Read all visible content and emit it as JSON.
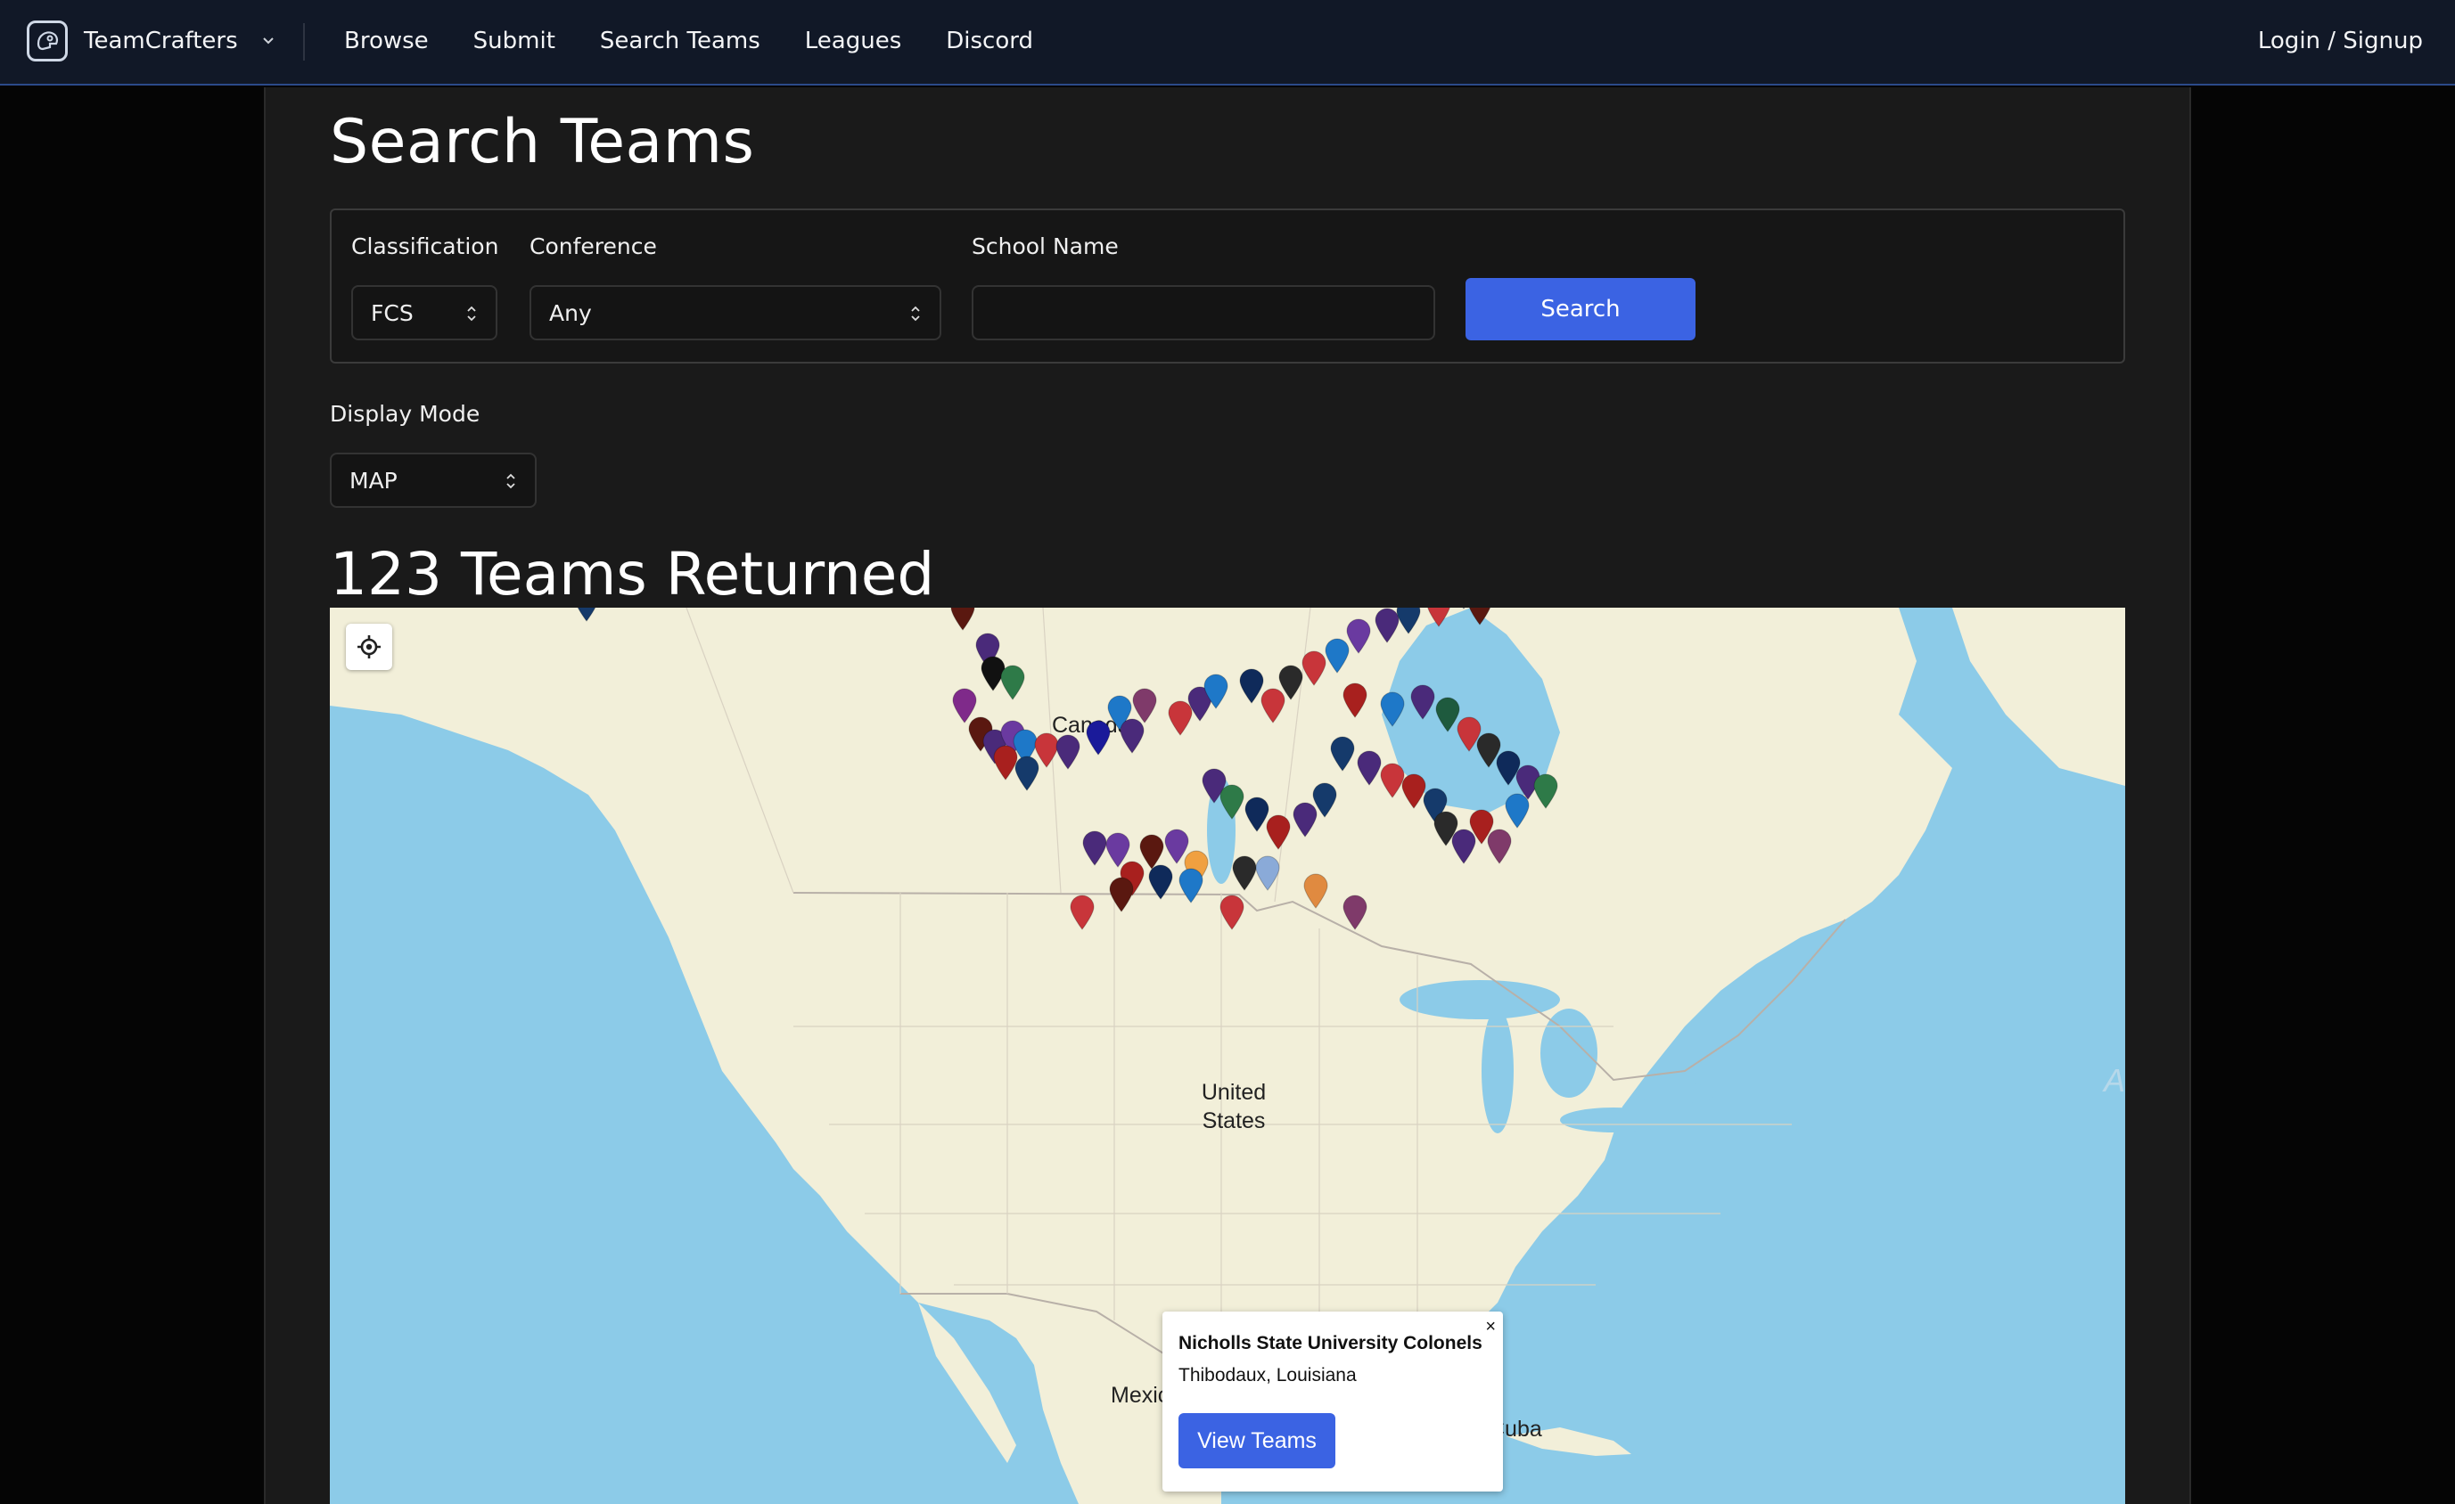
{
  "nav": {
    "brand": "TeamCrafters",
    "links": [
      "Browse",
      "Submit",
      "Search Teams",
      "Leagues",
      "Discord"
    ],
    "login": "Login / Signup"
  },
  "page": {
    "title": "Search Teams"
  },
  "filters": {
    "classification_label": "Classification",
    "classification_value": "FCS",
    "conference_label": "Conference",
    "conference_value": "Any",
    "school_label": "School Name",
    "school_value": "",
    "search_label": "Search"
  },
  "display": {
    "label": "Display Mode",
    "value": "MAP"
  },
  "results": {
    "title": "123 Teams Returned"
  },
  "map": {
    "labels": {
      "canada": "Canada",
      "us": "United\nStates",
      "mexico": "Mexico",
      "cuba": "Cuba",
      "atlantic": "A"
    },
    "popup": {
      "title": "Nicholls State University Colonels",
      "location": "Thibodaux, Louisiana",
      "close": "×",
      "button": "View Teams"
    }
  },
  "colors": {
    "accent": "#3b63e3",
    "navbar": "#111827",
    "ocean": "#8ccbe8",
    "land": "#f2efd9"
  },
  "icons": {
    "locate": "crosshair-icon",
    "brand": "helmet-logo-icon",
    "caret": "chevron-down-icon"
  }
}
